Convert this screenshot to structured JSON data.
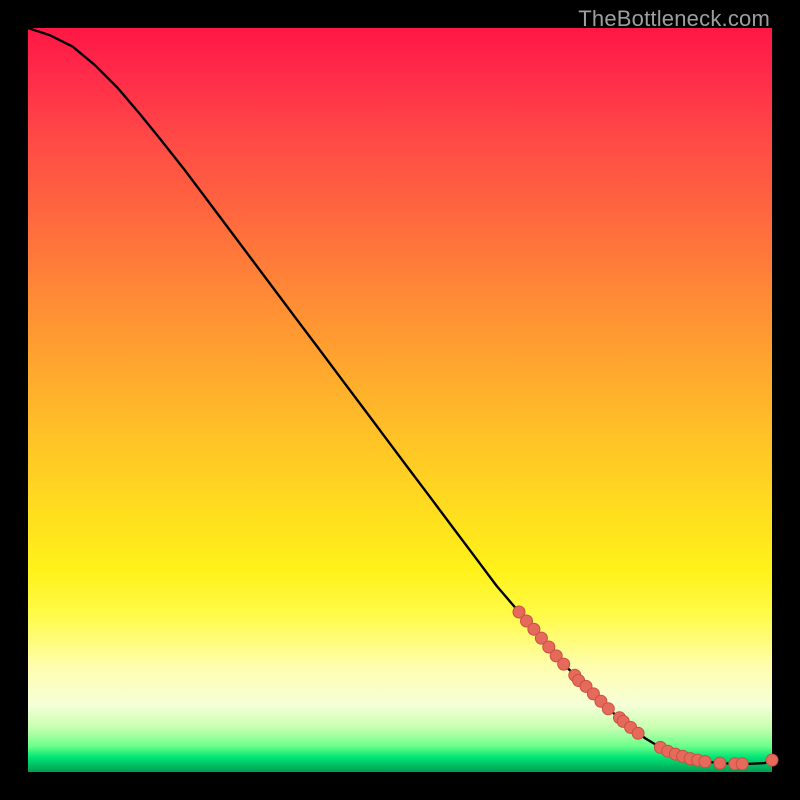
{
  "watermark": "TheBottleneck.com",
  "colors": {
    "frame_bg": "#000000",
    "curve_stroke": "#000000",
    "marker_fill": "#e66a5c",
    "marker_stroke": "#c9503f",
    "gradient_top": "#ff1744",
    "gradient_mid": "#ffe01e",
    "gradient_bottom": "#00e676"
  },
  "chart_data": {
    "type": "line",
    "title": "",
    "xlabel": "",
    "ylabel": "",
    "xlim": [
      0,
      100
    ],
    "ylim": [
      0,
      100
    ],
    "grid": false,
    "legend": false,
    "series": [
      {
        "name": "bottleneck_curve",
        "x": [
          0,
          3,
          6,
          9,
          12,
          15,
          18,
          21,
          24,
          27,
          30,
          33,
          36,
          39,
          42,
          45,
          48,
          51,
          54,
          57,
          60,
          63,
          66,
          69,
          72,
          75,
          78,
          81,
          83,
          85,
          87,
          89,
          91,
          93,
          95,
          97,
          99,
          100
        ],
        "y": [
          100,
          99,
          97.5,
          95,
          92,
          88.5,
          84.8,
          81,
          77,
          73,
          69,
          65,
          61,
          57,
          53,
          49,
          45,
          41,
          37,
          33,
          29,
          25,
          21.5,
          18,
          14.5,
          11.5,
          8.5,
          6,
          4.5,
          3.3,
          2.4,
          1.8,
          1.4,
          1.2,
          1.1,
          1.1,
          1.2,
          1.6
        ]
      }
    ],
    "markers": [
      {
        "x": 66,
        "y": 21.5
      },
      {
        "x": 67,
        "y": 20.3
      },
      {
        "x": 68,
        "y": 19.2
      },
      {
        "x": 69,
        "y": 18.0
      },
      {
        "x": 70,
        "y": 16.8
      },
      {
        "x": 71,
        "y": 15.6
      },
      {
        "x": 72,
        "y": 14.5
      },
      {
        "x": 73.5,
        "y": 13.0
      },
      {
        "x": 74,
        "y": 12.3
      },
      {
        "x": 75,
        "y": 11.5
      },
      {
        "x": 76,
        "y": 10.5
      },
      {
        "x": 77,
        "y": 9.5
      },
      {
        "x": 78,
        "y": 8.5
      },
      {
        "x": 79.5,
        "y": 7.3
      },
      {
        "x": 80,
        "y": 6.8
      },
      {
        "x": 81,
        "y": 6.0
      },
      {
        "x": 82,
        "y": 5.2
      },
      {
        "x": 85,
        "y": 3.3
      },
      {
        "x": 86,
        "y": 2.8
      },
      {
        "x": 87,
        "y": 2.4
      },
      {
        "x": 88,
        "y": 2.1
      },
      {
        "x": 89,
        "y": 1.8
      },
      {
        "x": 90,
        "y": 1.6
      },
      {
        "x": 91,
        "y": 1.4
      },
      {
        "x": 93,
        "y": 1.2
      },
      {
        "x": 95,
        "y": 1.1
      },
      {
        "x": 96,
        "y": 1.1
      },
      {
        "x": 100,
        "y": 1.6
      }
    ]
  }
}
